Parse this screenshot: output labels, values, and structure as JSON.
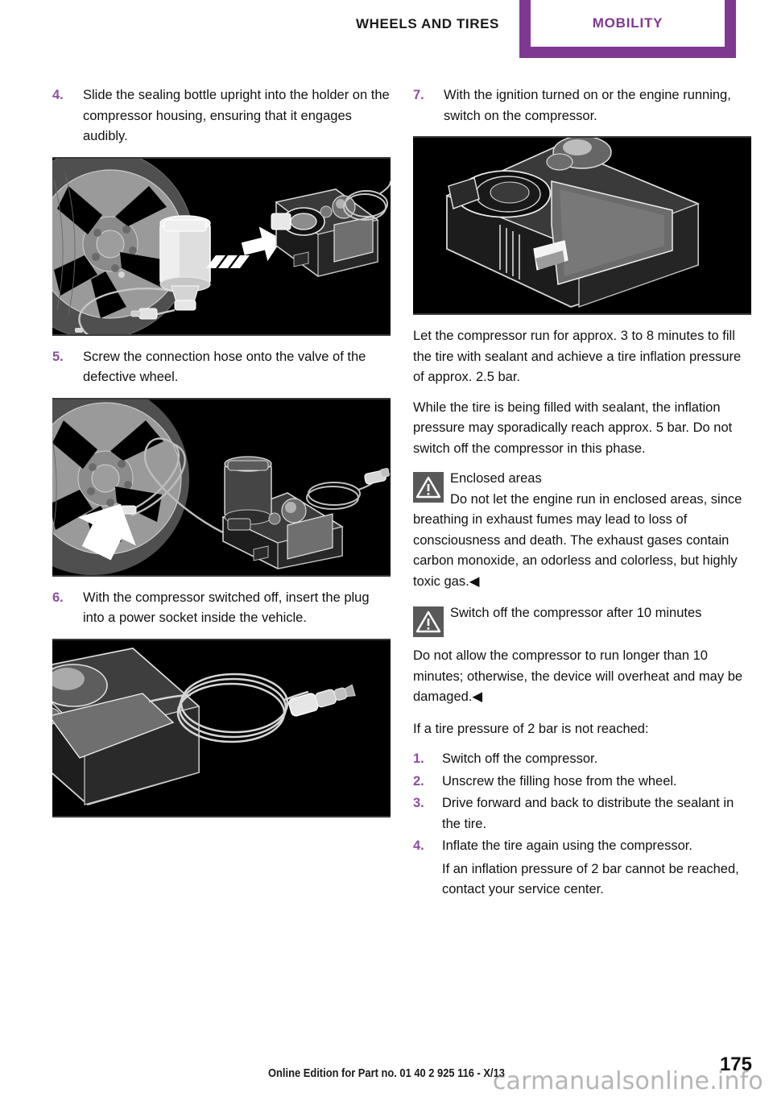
{
  "header": {
    "section_title": "WHEELS AND TIRES",
    "tab_label": "MOBILITY",
    "tab_color": "#7f3891",
    "accent_color": "#8d4ea0"
  },
  "left_column": {
    "steps": [
      {
        "number": "4.",
        "text": "Slide the sealing bottle upright into the holder on the compressor housing, ensuring that it engages audibly.",
        "figure_caption": "wheel-bottle-compressor-insert-illustration"
      },
      {
        "number": "5.",
        "text": "Screw the connection hose onto the valve of the defective wheel.",
        "figure_caption": "wheel-hose-connection-illustration"
      },
      {
        "number": "6.",
        "text": "With the compressor switched off, insert the plug into a power socket inside the vehicle.",
        "figure_caption": "compressor-power-plug-illustration"
      }
    ]
  },
  "right_column": {
    "step7": {
      "number": "7.",
      "text": "With the ignition turned on or the engine running, switch on the compressor.",
      "figure_caption": "compressor-switch-on-illustration"
    },
    "paragraphs": [
      "Let the compressor run for approx. 3 to 8 minutes to fill the tire with sealant and achieve a tire inflation pressure of approx. 2.5 bar.",
      "While the tire is being filled with sealant, the inflation pressure may sporadically reach approx. 5 bar. Do not switch off the compressor in this phase."
    ],
    "warnings": [
      {
        "title": "Enclosed areas",
        "body": "Do not let the engine run in enclosed areas, since breathing in exhaust fumes may lead to loss of consciousness and death. The exhaust gases contain carbon monoxide, an odorless and colorless, but highly toxic gas.◀"
      },
      {
        "title": "Switch off the compressor after 10 minutes",
        "body": "Do not allow the compressor to run longer than 10 minutes; otherwise, the device will overheat and may be damaged.◀"
      }
    ],
    "condition_intro": "If a tire pressure of 2 bar is not reached:",
    "numbered_list": [
      {
        "number": "1.",
        "text": "Switch off the compressor."
      },
      {
        "number": "2.",
        "text": "Unscrew the filling hose from the wheel."
      },
      {
        "number": "3.",
        "text": "Drive forward and back to distribute the sealant in the tire."
      },
      {
        "number": "4.",
        "text": "Inflate the tire again using the compressor.",
        "sub": "If an inflation pressure of 2 bar cannot be reached, contact your service center."
      }
    ]
  },
  "footer": {
    "edition": "Online Edition for Part no. 01 40 2 925 116 - X/13",
    "page_number": "175",
    "watermark": "carmanualsonline.info"
  }
}
